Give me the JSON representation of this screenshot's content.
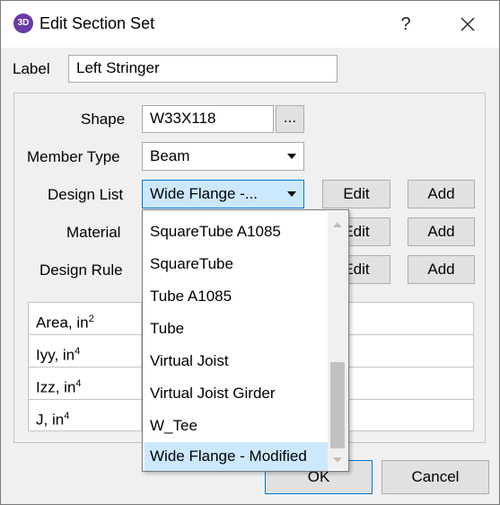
{
  "window": {
    "title": "Edit Section Set",
    "app_icon_text": "3D",
    "help": "?",
    "close": "close"
  },
  "label_field": {
    "label": "Label",
    "value": "Left Stringer"
  },
  "form": {
    "shape": {
      "label": "Shape",
      "value": "W33X118",
      "browse_label": "..."
    },
    "member_type": {
      "label": "Member Type",
      "value": "Beam"
    },
    "design_list": {
      "label": "Design List",
      "value": "Wide Flange -...",
      "edit_label": "Edit",
      "add_label": "Add"
    },
    "material": {
      "label": "Material",
      "edit_label": "Edit",
      "add_label": "Add"
    },
    "design_rule": {
      "label": "Design Rule",
      "edit_label": "Edit",
      "add_label": "Add"
    }
  },
  "properties": [
    {
      "name": "Area, in",
      "exp": "2"
    },
    {
      "name": "Iyy, in",
      "exp": "4"
    },
    {
      "name": "Izz, in",
      "exp": "4"
    },
    {
      "name": "J, in",
      "exp": "4"
    }
  ],
  "dropdown": {
    "items": [
      "SquareTube A1085",
      "SquareTube",
      "Tube A1085",
      "Tube",
      "Virtual Joist",
      "Virtual Joist Girder",
      "W_Tee",
      "Wide Flange - Modified"
    ],
    "selected_index": 7
  },
  "buttons": {
    "ok": "OK",
    "cancel": "Cancel"
  },
  "icons": {
    "app": "app-3d-icon",
    "close": "close-icon",
    "caret": "chevron-down-icon"
  },
  "colors": {
    "accent": "#0078d7",
    "selection": "#cce8ff",
    "app_icon": "#6a3aa8"
  }
}
